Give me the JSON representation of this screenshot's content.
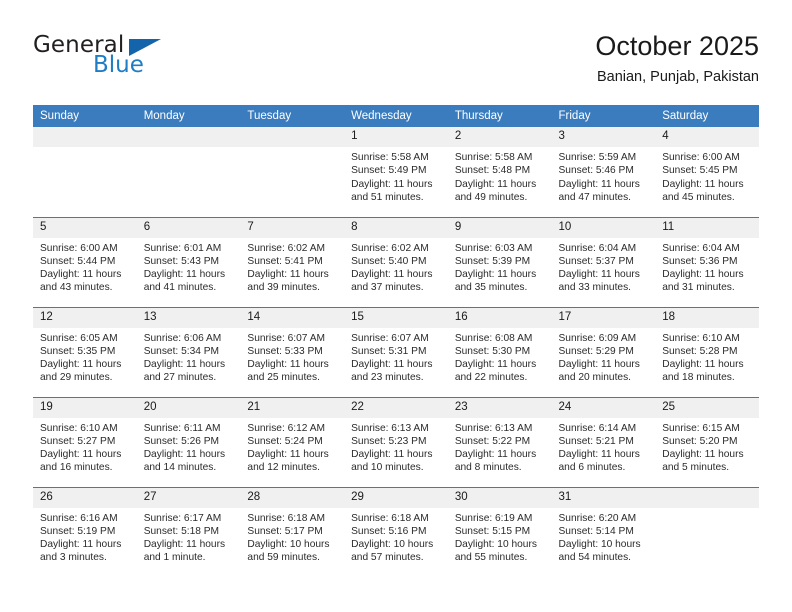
{
  "brand": {
    "name_part1": "General",
    "name_part2": "Blue",
    "triangle_color": "#1464ab",
    "blue_color": "#1f7dc4"
  },
  "header": {
    "title": "October 2025",
    "subtitle": "Banian, Punjab, Pakistan"
  },
  "theme": {
    "header_blue": "#3a7cbe",
    "daynum_gray": "#f0f0f0",
    "text": "#1a1a1a"
  },
  "weekdays": [
    "Sunday",
    "Monday",
    "Tuesday",
    "Wednesday",
    "Thursday",
    "Friday",
    "Saturday"
  ],
  "weeks": [
    [
      {
        "day": "",
        "lines": []
      },
      {
        "day": "",
        "lines": []
      },
      {
        "day": "",
        "lines": []
      },
      {
        "day": "1",
        "lines": [
          "Sunrise: 5:58 AM",
          "Sunset: 5:49 PM",
          "Daylight: 11 hours",
          "and 51 minutes."
        ]
      },
      {
        "day": "2",
        "lines": [
          "Sunrise: 5:58 AM",
          "Sunset: 5:48 PM",
          "Daylight: 11 hours",
          "and 49 minutes."
        ]
      },
      {
        "day": "3",
        "lines": [
          "Sunrise: 5:59 AM",
          "Sunset: 5:46 PM",
          "Daylight: 11 hours",
          "and 47 minutes."
        ]
      },
      {
        "day": "4",
        "lines": [
          "Sunrise: 6:00 AM",
          "Sunset: 5:45 PM",
          "Daylight: 11 hours",
          "and 45 minutes."
        ]
      }
    ],
    [
      {
        "day": "5",
        "lines": [
          "Sunrise: 6:00 AM",
          "Sunset: 5:44 PM",
          "Daylight: 11 hours",
          "and 43 minutes."
        ]
      },
      {
        "day": "6",
        "lines": [
          "Sunrise: 6:01 AM",
          "Sunset: 5:43 PM",
          "Daylight: 11 hours",
          "and 41 minutes."
        ]
      },
      {
        "day": "7",
        "lines": [
          "Sunrise: 6:02 AM",
          "Sunset: 5:41 PM",
          "Daylight: 11 hours",
          "and 39 minutes."
        ]
      },
      {
        "day": "8",
        "lines": [
          "Sunrise: 6:02 AM",
          "Sunset: 5:40 PM",
          "Daylight: 11 hours",
          "and 37 minutes."
        ]
      },
      {
        "day": "9",
        "lines": [
          "Sunrise: 6:03 AM",
          "Sunset: 5:39 PM",
          "Daylight: 11 hours",
          "and 35 minutes."
        ]
      },
      {
        "day": "10",
        "lines": [
          "Sunrise: 6:04 AM",
          "Sunset: 5:37 PM",
          "Daylight: 11 hours",
          "and 33 minutes."
        ]
      },
      {
        "day": "11",
        "lines": [
          "Sunrise: 6:04 AM",
          "Sunset: 5:36 PM",
          "Daylight: 11 hours",
          "and 31 minutes."
        ]
      }
    ],
    [
      {
        "day": "12",
        "lines": [
          "Sunrise: 6:05 AM",
          "Sunset: 5:35 PM",
          "Daylight: 11 hours",
          "and 29 minutes."
        ]
      },
      {
        "day": "13",
        "lines": [
          "Sunrise: 6:06 AM",
          "Sunset: 5:34 PM",
          "Daylight: 11 hours",
          "and 27 minutes."
        ]
      },
      {
        "day": "14",
        "lines": [
          "Sunrise: 6:07 AM",
          "Sunset: 5:33 PM",
          "Daylight: 11 hours",
          "and 25 minutes."
        ]
      },
      {
        "day": "15",
        "lines": [
          "Sunrise: 6:07 AM",
          "Sunset: 5:31 PM",
          "Daylight: 11 hours",
          "and 23 minutes."
        ]
      },
      {
        "day": "16",
        "lines": [
          "Sunrise: 6:08 AM",
          "Sunset: 5:30 PM",
          "Daylight: 11 hours",
          "and 22 minutes."
        ]
      },
      {
        "day": "17",
        "lines": [
          "Sunrise: 6:09 AM",
          "Sunset: 5:29 PM",
          "Daylight: 11 hours",
          "and 20 minutes."
        ]
      },
      {
        "day": "18",
        "lines": [
          "Sunrise: 6:10 AM",
          "Sunset: 5:28 PM",
          "Daylight: 11 hours",
          "and 18 minutes."
        ]
      }
    ],
    [
      {
        "day": "19",
        "lines": [
          "Sunrise: 6:10 AM",
          "Sunset: 5:27 PM",
          "Daylight: 11 hours",
          "and 16 minutes."
        ]
      },
      {
        "day": "20",
        "lines": [
          "Sunrise: 6:11 AM",
          "Sunset: 5:26 PM",
          "Daylight: 11 hours",
          "and 14 minutes."
        ]
      },
      {
        "day": "21",
        "lines": [
          "Sunrise: 6:12 AM",
          "Sunset: 5:24 PM",
          "Daylight: 11 hours",
          "and 12 minutes."
        ]
      },
      {
        "day": "22",
        "lines": [
          "Sunrise: 6:13 AM",
          "Sunset: 5:23 PM",
          "Daylight: 11 hours",
          "and 10 minutes."
        ]
      },
      {
        "day": "23",
        "lines": [
          "Sunrise: 6:13 AM",
          "Sunset: 5:22 PM",
          "Daylight: 11 hours",
          "and 8 minutes."
        ]
      },
      {
        "day": "24",
        "lines": [
          "Sunrise: 6:14 AM",
          "Sunset: 5:21 PM",
          "Daylight: 11 hours",
          "and 6 minutes."
        ]
      },
      {
        "day": "25",
        "lines": [
          "Sunrise: 6:15 AM",
          "Sunset: 5:20 PM",
          "Daylight: 11 hours",
          "and 5 minutes."
        ]
      }
    ],
    [
      {
        "day": "26",
        "lines": [
          "Sunrise: 6:16 AM",
          "Sunset: 5:19 PM",
          "Daylight: 11 hours",
          "and 3 minutes."
        ]
      },
      {
        "day": "27",
        "lines": [
          "Sunrise: 6:17 AM",
          "Sunset: 5:18 PM",
          "Daylight: 11 hours",
          "and 1 minute."
        ]
      },
      {
        "day": "28",
        "lines": [
          "Sunrise: 6:18 AM",
          "Sunset: 5:17 PM",
          "Daylight: 10 hours",
          "and 59 minutes."
        ]
      },
      {
        "day": "29",
        "lines": [
          "Sunrise: 6:18 AM",
          "Sunset: 5:16 PM",
          "Daylight: 10 hours",
          "and 57 minutes."
        ]
      },
      {
        "day": "30",
        "lines": [
          "Sunrise: 6:19 AM",
          "Sunset: 5:15 PM",
          "Daylight: 10 hours",
          "and 55 minutes."
        ]
      },
      {
        "day": "31",
        "lines": [
          "Sunrise: 6:20 AM",
          "Sunset: 5:14 PM",
          "Daylight: 10 hours",
          "and 54 minutes."
        ]
      },
      {
        "day": "",
        "lines": []
      }
    ]
  ]
}
